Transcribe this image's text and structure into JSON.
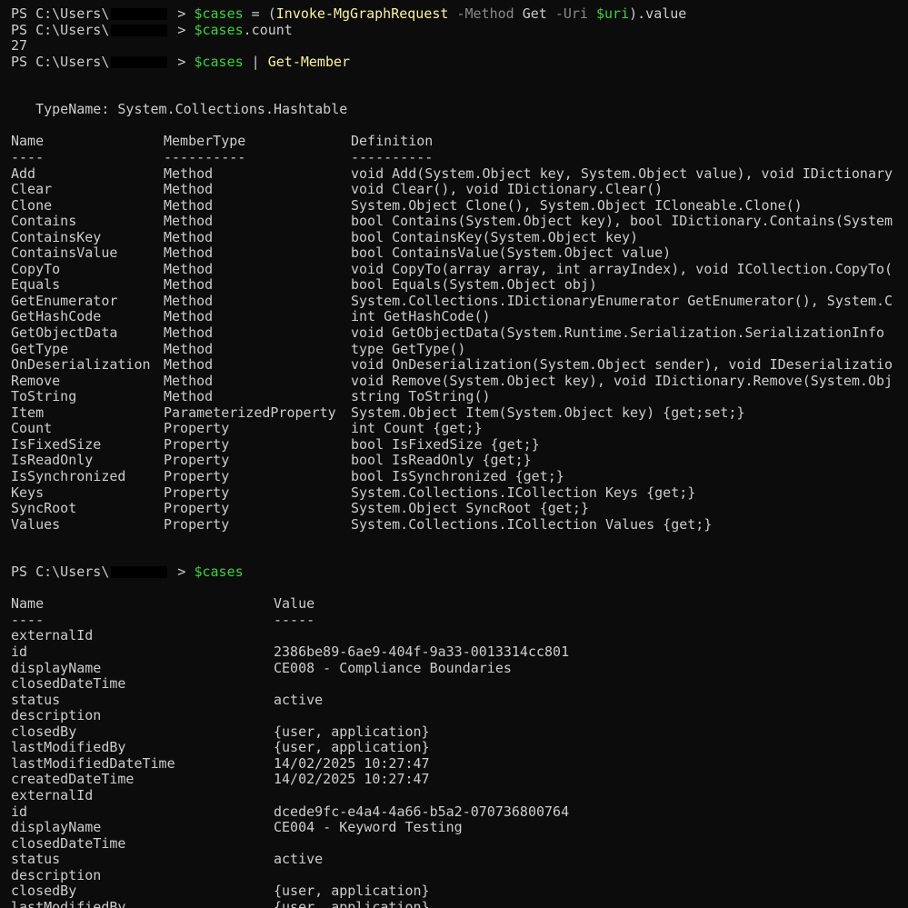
{
  "prompts": [
    {
      "prompt_prefix": "PS C:\\Users\\",
      "prompt_suffix": " > ",
      "parts": [
        {
          "text": "$cases",
          "kind": "var"
        },
        {
          "text": " = (",
          "kind": "plain"
        },
        {
          "text": "Invoke-MgGraphRequest",
          "kind": "cmd"
        },
        {
          "text": " -Method",
          "kind": "param"
        },
        {
          "text": " Get",
          "kind": "plain"
        },
        {
          "text": " -Uri",
          "kind": "param"
        },
        {
          "text": " ",
          "kind": "plain"
        },
        {
          "text": "$uri",
          "kind": "var"
        },
        {
          "text": ").value",
          "kind": "plain"
        }
      ]
    },
    {
      "prompt_prefix": "PS C:\\Users\\",
      "prompt_suffix": " > ",
      "parts": [
        {
          "text": "$cases",
          "kind": "var"
        },
        {
          "text": ".count",
          "kind": "plain"
        }
      ]
    },
    {
      "prompt_prefix": "PS C:\\Users\\",
      "prompt_suffix": " > ",
      "parts": [
        {
          "text": "$cases",
          "kind": "var"
        },
        {
          "text": " | ",
          "kind": "plain"
        },
        {
          "text": "Get-Member",
          "kind": "cmd"
        }
      ]
    },
    {
      "prompt_prefix": "PS C:\\Users\\",
      "prompt_suffix": " > ",
      "parts": [
        {
          "text": "$cases",
          "kind": "var"
        }
      ]
    }
  ],
  "count_output": "27",
  "type_name": "   TypeName: System.Collections.Hashtable",
  "members_headers": [
    "Name",
    "MemberType",
    "Definition"
  ],
  "members_underlines": [
    "----",
    "----------",
    "----------"
  ],
  "members": [
    [
      "Add",
      "Method",
      "void Add(System.Object key, System.Object value), void IDictionary"
    ],
    [
      "Clear",
      "Method",
      "void Clear(), void IDictionary.Clear()"
    ],
    [
      "Clone",
      "Method",
      "System.Object Clone(), System.Object ICloneable.Clone()"
    ],
    [
      "Contains",
      "Method",
      "bool Contains(System.Object key), bool IDictionary.Contains(System"
    ],
    [
      "ContainsKey",
      "Method",
      "bool ContainsKey(System.Object key)"
    ],
    [
      "ContainsValue",
      "Method",
      "bool ContainsValue(System.Object value)"
    ],
    [
      "CopyTo",
      "Method",
      "void CopyTo(array array, int arrayIndex), void ICollection.CopyTo("
    ],
    [
      "Equals",
      "Method",
      "bool Equals(System.Object obj)"
    ],
    [
      "GetEnumerator",
      "Method",
      "System.Collections.IDictionaryEnumerator GetEnumerator(), System.C"
    ],
    [
      "GetHashCode",
      "Method",
      "int GetHashCode()"
    ],
    [
      "GetObjectData",
      "Method",
      "void GetObjectData(System.Runtime.Serialization.SerializationInfo "
    ],
    [
      "GetType",
      "Method",
      "type GetType()"
    ],
    [
      "OnDeserialization",
      "Method",
      "void OnDeserialization(System.Object sender), void IDeserializatio"
    ],
    [
      "Remove",
      "Method",
      "void Remove(System.Object key), void IDictionary.Remove(System.Obj"
    ],
    [
      "ToString",
      "Method",
      "string ToString()"
    ],
    [
      "Item",
      "ParameterizedProperty",
      "System.Object Item(System.Object key) {get;set;}"
    ],
    [
      "Count",
      "Property",
      "int Count {get;}"
    ],
    [
      "IsFixedSize",
      "Property",
      "bool IsFixedSize {get;}"
    ],
    [
      "IsReadOnly",
      "Property",
      "bool IsReadOnly {get;}"
    ],
    [
      "IsSynchronized",
      "Property",
      "bool IsSynchronized {get;}"
    ],
    [
      "Keys",
      "Property",
      "System.Collections.ICollection Keys {get;}"
    ],
    [
      "SyncRoot",
      "Property",
      "System.Object SyncRoot {get;}"
    ],
    [
      "Values",
      "Property",
      "System.Collections.ICollection Values {get;}"
    ]
  ],
  "values_headers": [
    "Name",
    "Value"
  ],
  "values_underlines": [
    "----",
    "-----"
  ],
  "values": [
    [
      "externalId",
      ""
    ],
    [
      "id",
      "2386be89-6ae9-404f-9a33-0013314cc801"
    ],
    [
      "displayName",
      "CE008 - Compliance Boundaries"
    ],
    [
      "closedDateTime",
      ""
    ],
    [
      "status",
      "active"
    ],
    [
      "description",
      ""
    ],
    [
      "closedBy",
      "{user, application}"
    ],
    [
      "lastModifiedBy",
      "{user, application}"
    ],
    [
      "lastModifiedDateTime",
      "14/02/2025 10:27:47"
    ],
    [
      "createdDateTime",
      "14/02/2025 10:27:47"
    ],
    [
      "externalId",
      ""
    ],
    [
      "id",
      "dcede9fc-e4a4-4a66-b5a2-070736800764"
    ],
    [
      "displayName",
      "CE004 - Keyword Testing"
    ],
    [
      "closedDateTime",
      ""
    ],
    [
      "status",
      "active"
    ],
    [
      "description",
      ""
    ],
    [
      "closedBy",
      "{user, application}"
    ],
    [
      "lastModifiedBy",
      "{user, application}"
    ]
  ],
  "colors": {
    "background": "#0c0c0c",
    "text": "#cccccc",
    "variable": "#3bd13b",
    "command": "#f9f1a5",
    "parameter": "#8a8a8a"
  }
}
